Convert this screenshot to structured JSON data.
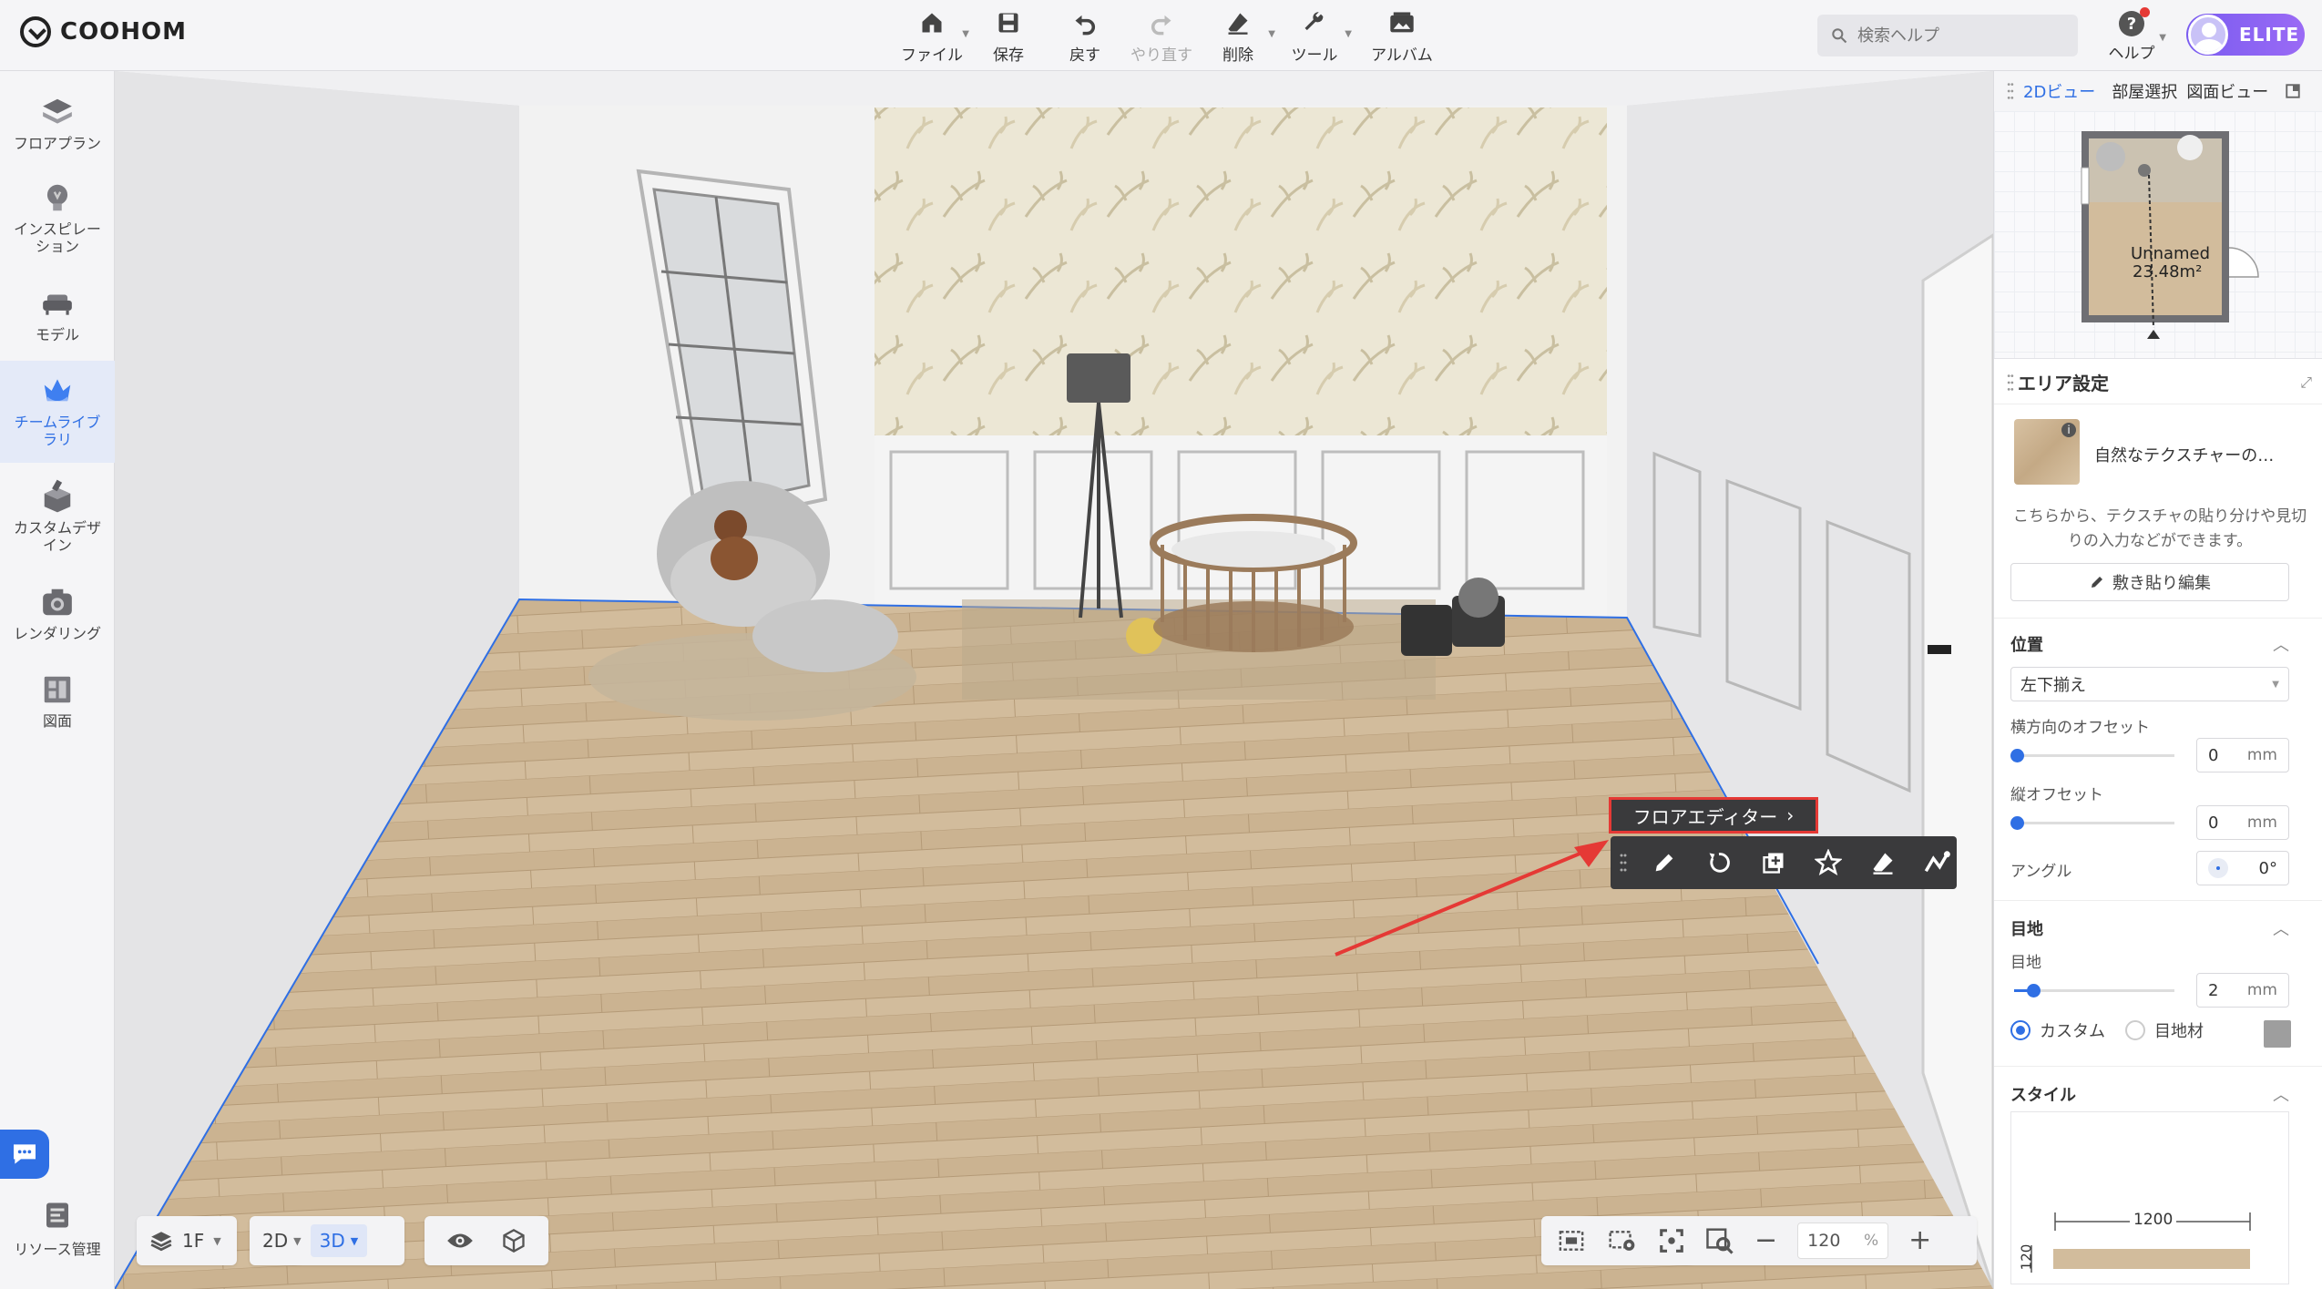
{
  "app": {
    "logo_text": "COOHOM"
  },
  "toolbar": {
    "items": [
      {
        "label": "ファイル",
        "icon": "home-icon",
        "caret": true,
        "disabled": false
      },
      {
        "label": "保存",
        "icon": "save-icon",
        "caret": false,
        "disabled": false
      },
      {
        "label": "戻す",
        "icon": "undo-icon",
        "caret": false,
        "disabled": false
      },
      {
        "label": "やり直す",
        "icon": "redo-icon",
        "caret": false,
        "disabled": true
      },
      {
        "label": "削除",
        "icon": "eraser-icon",
        "caret": true,
        "disabled": false
      },
      {
        "label": "ツール",
        "icon": "wrench-icon",
        "caret": true,
        "disabled": false
      },
      {
        "label": "アルバム",
        "icon": "album-icon",
        "caret": false,
        "disabled": false
      }
    ]
  },
  "search": {
    "placeholder": "検索ヘルプ"
  },
  "help": {
    "label": "ヘルプ"
  },
  "user": {
    "badge": "ELITE"
  },
  "sidebar": {
    "items": [
      {
        "label": "フロアプラン",
        "icon": "floorplan-icon",
        "active": false
      },
      {
        "label": "インスピレーション",
        "icon": "lightbulb-icon",
        "active": false
      },
      {
        "label": "モデル",
        "icon": "sofa-icon",
        "active": false
      },
      {
        "label": "チームライブラリ",
        "icon": "crown-icon",
        "active": true
      },
      {
        "label": "カスタムデザイン",
        "icon": "custom-design-icon",
        "active": false
      },
      {
        "label": "レンダリング",
        "icon": "camera-icon",
        "active": false
      },
      {
        "label": "図面",
        "icon": "drawing-icon",
        "active": false
      }
    ],
    "resource_label": "リソース管理"
  },
  "floor_editor": {
    "label": "フロアエディター",
    "tools": [
      "pencil-icon",
      "rotate-icon",
      "add-copy-icon",
      "star-icon",
      "eraser-icon",
      "brush-icon"
    ]
  },
  "bottom_left": {
    "floor": "1F",
    "view2d": "2D",
    "view3d": "3D"
  },
  "bottom_right": {
    "zoom_value": "120",
    "zoom_unit": "%"
  },
  "right_panel": {
    "tabs": [
      {
        "label": "2Dビュー",
        "active": true
      },
      {
        "label": "部屋選択",
        "active": false
      },
      {
        "label": "図面ビュー",
        "active": false
      }
    ],
    "minimap": {
      "room_name": "Unnamed",
      "room_area": "23.48m²"
    },
    "area_settings": {
      "title": "エリア設定",
      "material_name": "自然なテクスチャーの…",
      "description": "こちらから、テクスチャの貼り分けや見切りの入力などができます。",
      "edit_button": "敷き貼り編集",
      "position": {
        "title": "位置",
        "align_value": "左下揃え",
        "h_offset_label": "横方向のオフセット",
        "h_offset_value": "0",
        "v_offset_label": "縦オフセット",
        "v_offset_value": "0",
        "unit": "mm",
        "angle_label": "アングル",
        "angle_value": "0°"
      },
      "joint": {
        "title": "目地",
        "label": "目地",
        "value": "2",
        "unit": "mm",
        "value_fraction": 0.12,
        "option_custom": "カスタム",
        "option_material": "目地材"
      },
      "style": {
        "title": "スタイル",
        "width": "1200",
        "height": "120"
      }
    }
  }
}
